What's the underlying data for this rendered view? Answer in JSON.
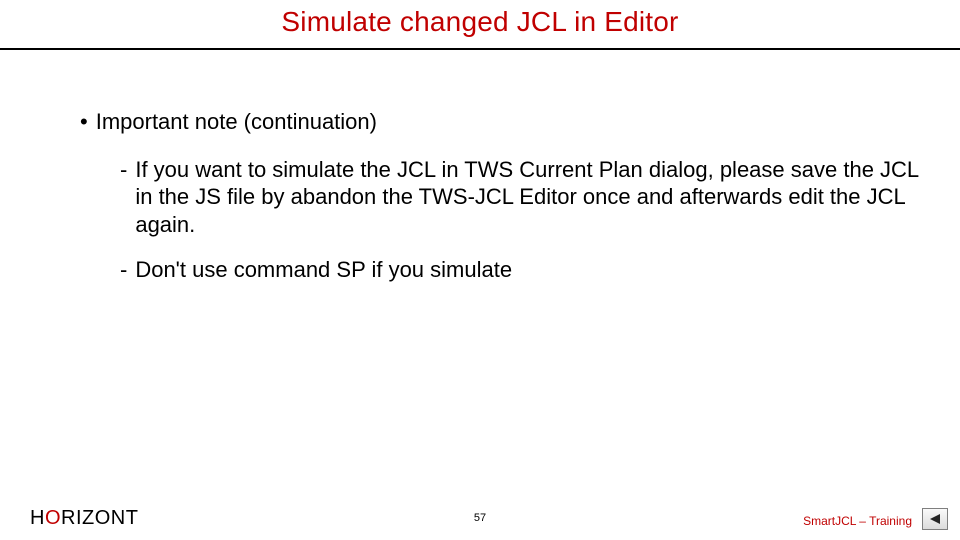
{
  "title": "Simulate changed JCL in Editor",
  "bullet": {
    "marker": "•",
    "text": "Important note (continuation)"
  },
  "sub": [
    {
      "dash": "-",
      "text": "If you want to simulate the JCL in TWS Current Plan dialog, please save the JCL in the JS file by abandon the TWS-JCL Editor once and afterwards edit the JCL again."
    },
    {
      "dash": "-",
      "text": "Don't use command SP if you simulate"
    }
  ],
  "footer": {
    "brand_pre": "H",
    "brand_accent": "O",
    "brand_post": "RIZONT",
    "page": "57",
    "course": "SmartJCL – Training"
  }
}
